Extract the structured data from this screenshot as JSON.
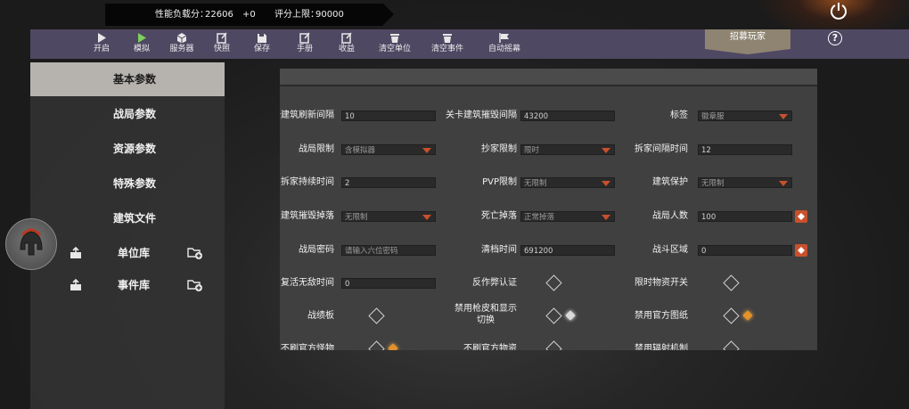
{
  "stats": {
    "perf_label": "性能负载分：",
    "perf_value": "22606",
    "perf_delta": "+0",
    "score_label": "评分上限：",
    "score_value": "90000"
  },
  "toolbar": {
    "items": [
      {
        "label": "开启",
        "icon": "play-icon"
      },
      {
        "label": "模拟",
        "icon": "play-green-icon"
      },
      {
        "label": "服务器",
        "icon": "server-icon"
      },
      {
        "label": "快照",
        "icon": "snapshot-icon"
      },
      {
        "label": "保存",
        "icon": "save-icon"
      },
      {
        "label": "手册",
        "icon": "manual-icon"
      },
      {
        "label": "收益",
        "icon": "revenue-icon"
      },
      {
        "label": "清空单位",
        "icon": "trash-icon"
      },
      {
        "label": "清空事件",
        "icon": "trash-icon"
      },
      {
        "label": "自动摇幕",
        "icon": "flag-icon"
      }
    ],
    "recruit_label": "招募玩家",
    "help_label": "?"
  },
  "sidebar": {
    "items": [
      {
        "label": "基本参数",
        "active": true
      },
      {
        "label": "战局参数",
        "active": false
      },
      {
        "label": "资源参数",
        "active": false
      },
      {
        "label": "特殊参数",
        "active": false
      },
      {
        "label": "建筑文件",
        "active": false
      },
      {
        "label": "单位库",
        "active": false
      },
      {
        "label": "事件库",
        "active": false
      }
    ]
  },
  "form": {
    "rows": [
      [
        {
          "label": "关卡建筑刷新间隔",
          "type": "input",
          "value": "10"
        },
        {
          "label": "关卡建筑摧毁间隔",
          "type": "input",
          "value": "43200"
        },
        {
          "label": "标签",
          "type": "select",
          "value": "徽章服"
        }
      ],
      [
        {
          "label": "战局限制",
          "type": "select",
          "value": "含模拟器"
        },
        {
          "label": "抄家限制",
          "type": "select",
          "value": "限时"
        },
        {
          "label": "拆家间隔时间",
          "type": "input",
          "value": "12"
        }
      ],
      [
        {
          "label": "拆家持续时间",
          "type": "input",
          "value": "2"
        },
        {
          "label": "PVP限制",
          "type": "select",
          "value": "无限制"
        },
        {
          "label": "建筑保护",
          "type": "select",
          "value": "无限制"
        }
      ],
      [
        {
          "label": "建筑摧毁掉落",
          "type": "select",
          "value": "无限制"
        },
        {
          "label": "死亡掉落",
          "type": "select",
          "value": "正常掉落"
        },
        {
          "label": "战局人数",
          "type": "input",
          "value": "100",
          "adjust": true
        }
      ],
      [
        {
          "label": "战局密码",
          "type": "input",
          "placeholder": "请输入六位密码"
        },
        {
          "label": "清档时间",
          "type": "input",
          "value": "691200"
        },
        {
          "label": "战斗区域",
          "type": "input",
          "value": "0",
          "adjust": true
        }
      ],
      [
        {
          "label": "复活无敌时间",
          "type": "input",
          "value": "0"
        },
        {
          "label": "反作弊认证",
          "type": "check"
        },
        {
          "label": "限时物资开关",
          "type": "check"
        }
      ],
      [
        {
          "label": "战绩板",
          "type": "check"
        },
        {
          "label": "禁用枪皮和显示",
          "label2": "切换",
          "type": "check",
          "star": "on"
        },
        {
          "label": "禁用官方图纸",
          "type": "check",
          "star": "gold"
        }
      ],
      [
        {
          "label": "不刷官方怪物",
          "type": "check",
          "star": "gold"
        },
        {
          "label": "不刷官方物资",
          "type": "check"
        },
        {
          "label": "禁用辐射机制",
          "type": "check"
        }
      ]
    ]
  },
  "colors": {
    "toolbar": "#4f4863",
    "recruit": "#8e8471",
    "accent_arrow": "#c9502c",
    "gold": "#e3922a"
  }
}
